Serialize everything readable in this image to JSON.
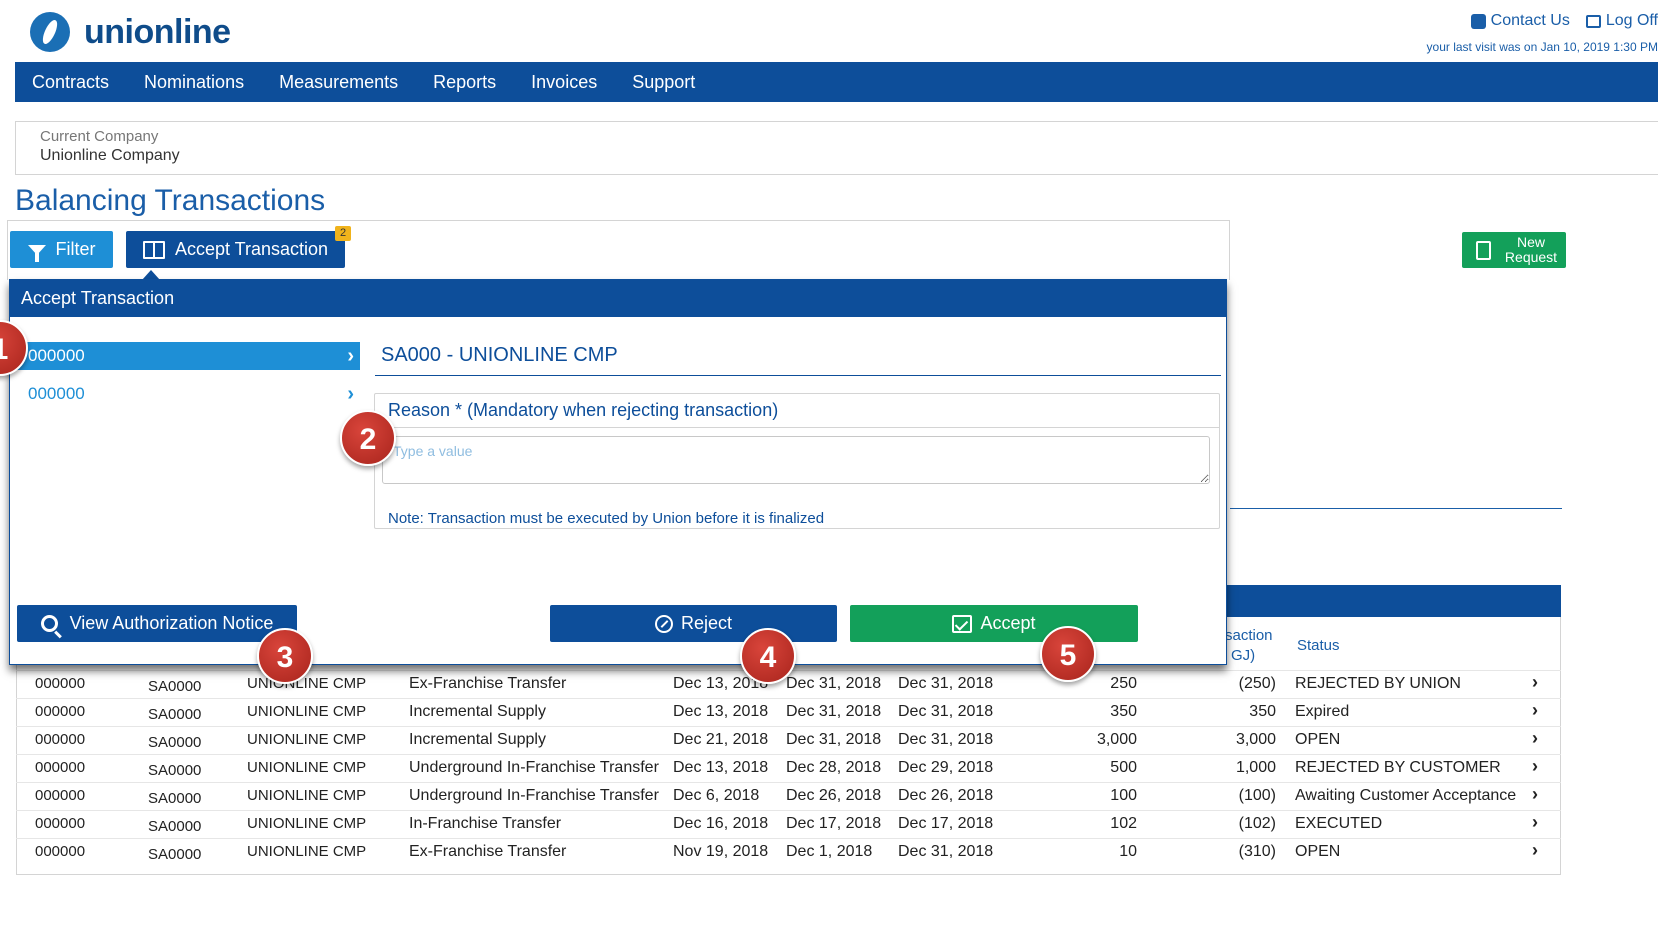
{
  "header": {
    "logo_text": "unionline",
    "contact_label": "Contact Us",
    "logoff_label": "Log Off",
    "last_visit": "your last visit was on Jan 10, 2019 1:30 PM"
  },
  "nav": {
    "items": [
      "Contracts",
      "Nominations",
      "Measurements",
      "Reports",
      "Invoices",
      "Support"
    ]
  },
  "company": {
    "label": "Current Company",
    "value": "Unionline Company"
  },
  "page_title": "Balancing Transactions",
  "toolbar": {
    "filter_label": "Filter",
    "accept_transaction_label": "Accept Transaction",
    "accept_badge": "2",
    "new_request_label": "New Request"
  },
  "table": {
    "headers": {
      "transaction_partial": "saction",
      "transaction_unit_partial": "GJ)",
      "status": "Status"
    },
    "rows": [
      {
        "contract": "000000",
        "sa": "SA0000",
        "company": "UNIONLINE CMP",
        "type": "Ex-Franchise Transfer",
        "d1": "Dec 13, 2018",
        "d2": "Dec 31, 2018",
        "d3": "Dec 31, 2018",
        "qty": "250",
        "trans": "(250)",
        "status": "REJECTED BY UNION"
      },
      {
        "contract": "000000",
        "sa": "SA0000",
        "company": "UNIONLINE CMP",
        "type": "Incremental Supply",
        "d1": "Dec 13, 2018",
        "d2": "Dec 31, 2018",
        "d3": "Dec 31, 2018",
        "qty": "350",
        "trans": "350",
        "status": "Expired"
      },
      {
        "contract": "000000",
        "sa": "SA0000",
        "company": "UNIONLINE CMP",
        "type": "Incremental Supply",
        "d1": "Dec 21, 2018",
        "d2": "Dec 31, 2018",
        "d3": "Dec 31, 2018",
        "qty": "3,000",
        "trans": "3,000",
        "status": "OPEN"
      },
      {
        "contract": "000000",
        "sa": "SA0000",
        "company": "UNIONLINE CMP",
        "type": "Underground In-Franchise Transfer",
        "d1": "Dec 13, 2018",
        "d2": "Dec 28, 2018",
        "d3": "Dec 29, 2018",
        "qty": "500",
        "trans": "1,000",
        "status": "REJECTED BY CUSTOMER"
      },
      {
        "contract": "000000",
        "sa": "SA0000",
        "company": "UNIONLINE CMP",
        "type": "Underground In-Franchise Transfer",
        "d1": "Dec 6, 2018",
        "d2": "Dec 26, 2018",
        "d3": "Dec 26, 2018",
        "qty": "100",
        "trans": "(100)",
        "status": "Awaiting Customer Acceptance"
      },
      {
        "contract": "000000",
        "sa": "SA0000",
        "company": "UNIONLINE CMP",
        "type": "In-Franchise Transfer",
        "d1": "Dec 16, 2018",
        "d2": "Dec 17, 2018",
        "d3": "Dec 17, 2018",
        "qty": "102",
        "trans": "(102)",
        "status": "EXECUTED"
      },
      {
        "contract": "000000",
        "sa": "SA0000",
        "company": "UNIONLINE CMP",
        "type": "Ex-Franchise Transfer",
        "d1": "Nov 19, 2018",
        "d2": "Dec 1, 2018",
        "d3": "Dec 31, 2018",
        "qty": "10",
        "trans": "(310)",
        "status": "OPEN"
      }
    ]
  },
  "modal": {
    "title": "Accept Transaction",
    "list": [
      "000000",
      "000000"
    ],
    "detail_title": "SA000 - UNIONLINE CMP",
    "reason_label": "Reason * (Mandatory when rejecting transaction)",
    "reason_value": "",
    "reason_placeholder": "Type a value",
    "note": "Note: Transaction must be executed by Union before it is finalized",
    "view_notice_label": "View Authorization Notice",
    "reject_label": "Reject",
    "accept_label": "Accept"
  },
  "markers": [
    "1",
    "2",
    "3",
    "4",
    "5"
  ],
  "icons": {
    "contact": "phone-icon",
    "logoff": "sign-out-icon",
    "filter": "filter-icon",
    "accept_transaction": "book-icon",
    "new_request": "document-icon",
    "view_notice": "search-icon",
    "reject": "ban-icon",
    "accept": "check-square-icon",
    "list_item": "chevron-right-icon"
  },
  "colors": {
    "primary": "#0d4e9a",
    "accent": "#1e8fd6",
    "success": "#13a05a",
    "badge": "#f0b31c",
    "marker": "#c0392b"
  }
}
